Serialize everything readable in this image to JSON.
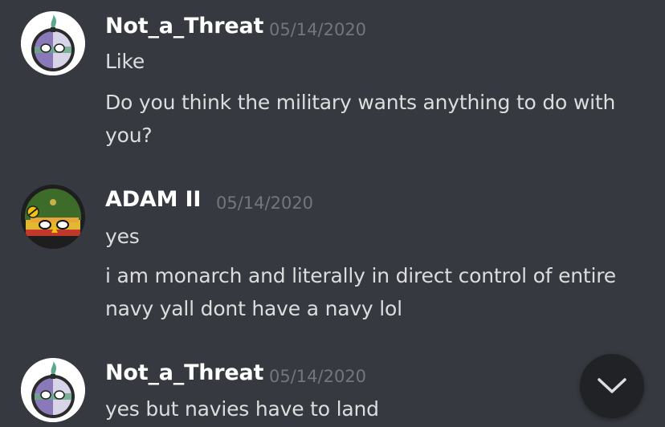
{
  "messages": [
    {
      "username": "Not_a_Threat",
      "timestamp": "05/14/2020",
      "avatar_icon": "not-a-threat-avatar",
      "lines": [
        "Like",
        "Do you think the military wants anything to do with you?"
      ]
    },
    {
      "username": "ADAM II",
      "timestamp": "05/14/2020",
      "avatar_icon": "adam-ii-avatar",
      "lines": [
        "yes",
        "i am monarch and literally in direct control of entire navy yall dont have a navy lol"
      ]
    },
    {
      "username": "Not_a_Threat",
      "timestamp": "05/14/2020",
      "avatar_icon": "not-a-threat-avatar",
      "lines": [
        "yes but navies have to land"
      ]
    }
  ],
  "scroll_button": {
    "icon": "chevron-down-icon"
  },
  "colors": {
    "background": "#36393f",
    "username": "#ffffff",
    "timestamp": "#72767d",
    "message_text": "#dcddde",
    "scroll_button_bg": "#202225"
  }
}
